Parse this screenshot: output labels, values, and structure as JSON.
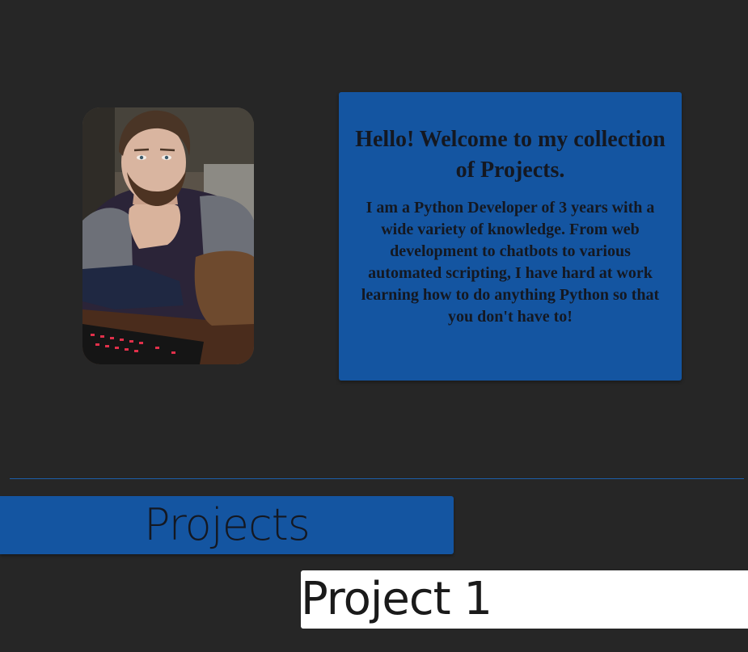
{
  "intro": {
    "title": "Hello! Welcome to my collection of Projects.",
    "body": "I am a Python Developer of 3 years with a wide variety of knowledge. From web development to chatbots to various automated scripting, I have hard at work learning how to do anything Python so that you don't have to!"
  },
  "projects": {
    "header": "Projects",
    "items": [
      {
        "label": "Project 1"
      }
    ]
  },
  "colors": {
    "background": "#262626",
    "accent": "#1455a1",
    "card": "#ffffff"
  }
}
